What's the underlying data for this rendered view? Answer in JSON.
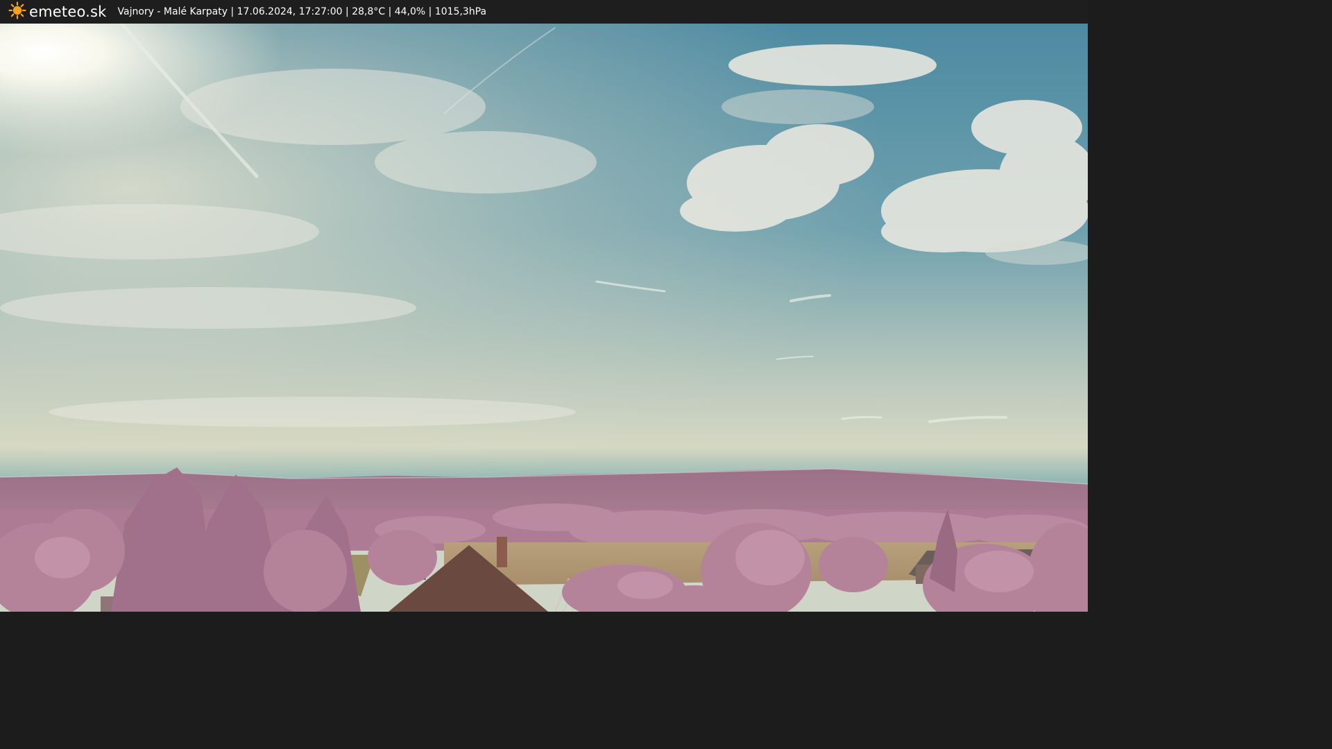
{
  "header": {
    "logo_icon": "sun-icon",
    "site_name": "emeteo.sk",
    "caption": "Vajnory - Malé Karpaty | 17.06.2024, 17:27:00 | 28,8°C | 44,0% | 1015,3hPa"
  },
  "colors": {
    "bar_background": "#1e1e1e",
    "sun_icon": "#f6a21c",
    "sky_top": "#4f8aa0",
    "sky_horizon": "#d9dcc6",
    "foliage": "#b07e95",
    "field": "#b49a78"
  }
}
